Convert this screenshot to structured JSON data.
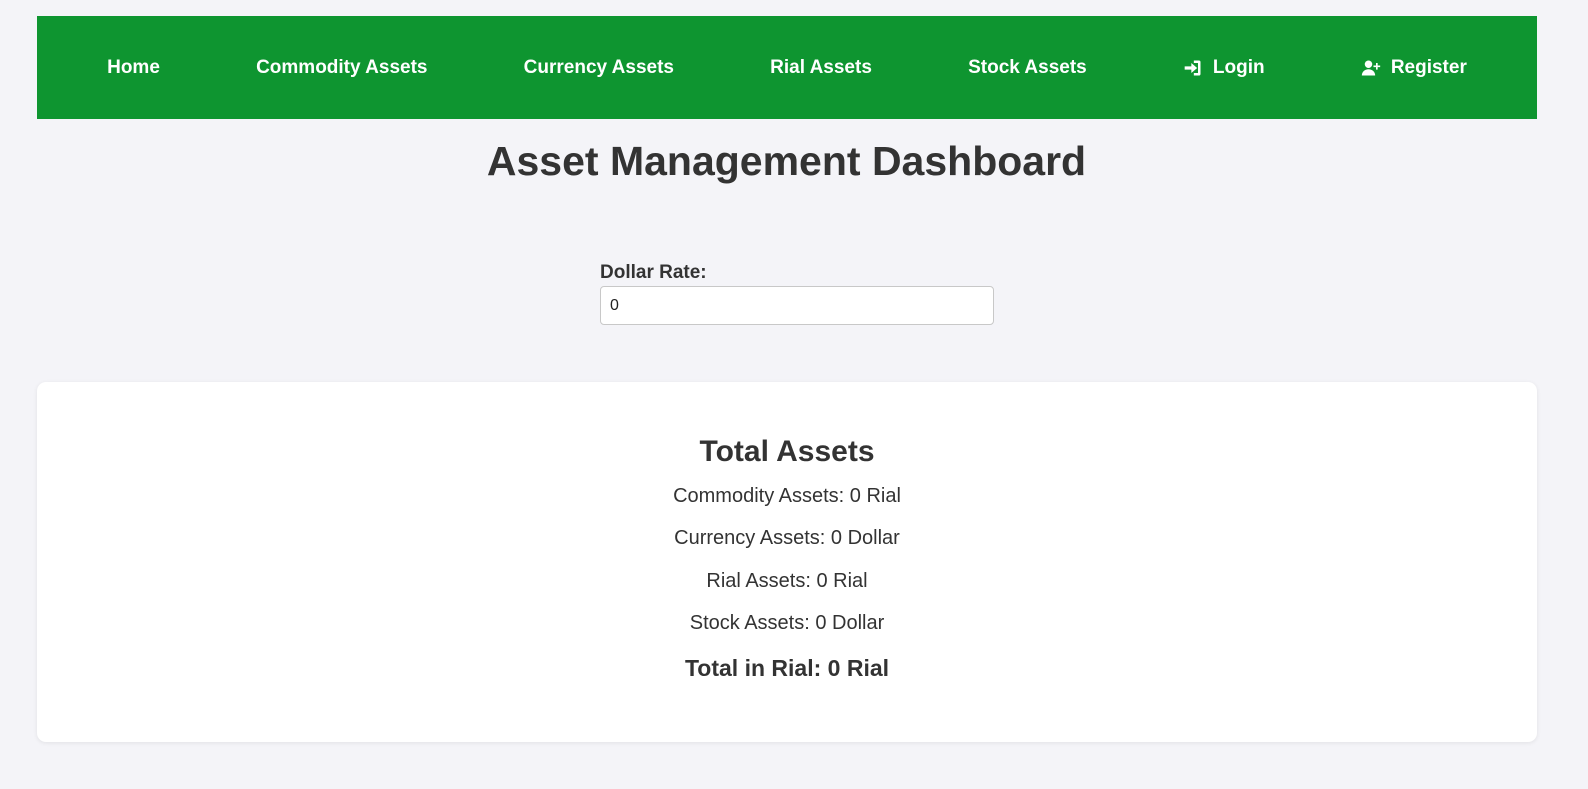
{
  "nav": {
    "items": [
      {
        "label": "Home",
        "icon": null
      },
      {
        "label": "Commodity Assets",
        "icon": null
      },
      {
        "label": "Currency Assets",
        "icon": null
      },
      {
        "label": "Rial Assets",
        "icon": null
      },
      {
        "label": "Stock Assets",
        "icon": null
      },
      {
        "label": "Login",
        "icon": "login-icon"
      },
      {
        "label": "Register",
        "icon": "user-plus-icon"
      }
    ],
    "background_color": "#0e9530"
  },
  "page": {
    "title": "Asset Management Dashboard"
  },
  "dollar_rate": {
    "label": "Dollar Rate:",
    "value": "0"
  },
  "summary": {
    "title": "Total Assets",
    "lines": [
      "Commodity Assets: 0 Rial",
      "Currency Assets: 0 Dollar",
      "Rial Assets: 0 Rial",
      "Stock Assets: 0 Dollar"
    ],
    "total": "Total in Rial: 0 Rial"
  }
}
